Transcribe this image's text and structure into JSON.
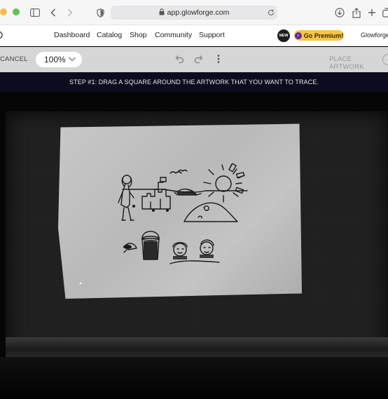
{
  "browser": {
    "url": "app.glowforge.com"
  },
  "nav": {
    "links": [
      "Dashboard",
      "Catalog",
      "Shop",
      "Community",
      "Support"
    ],
    "new_badge": "NEW",
    "premium_label": "Go Premium!",
    "account_label": "Glowforge"
  },
  "toolbar": {
    "cancel_label": "CANCEL",
    "zoom_value": "100%",
    "place_artwork_label": "PLACE ARTWORK"
  },
  "banner": {
    "step_text": "STEP #1: DRAG A SQUARE AROUND THE ARTWORK THAT YOU WANT TO TRACE."
  },
  "colors": {
    "banner_bg": "#0d0c1f",
    "premium_bg": "#f7c548",
    "toolbar_bg": "#d6d6d6"
  },
  "icons": [
    "sidebar-icon",
    "back-icon",
    "forward-icon",
    "shield-icon",
    "lock-icon",
    "reload-icon",
    "download-icon",
    "share-icon",
    "new-tab-icon",
    "tabs-icon",
    "undo-icon",
    "redo-icon",
    "more-icon",
    "bolt-icon",
    "chevron-down-icon"
  ]
}
